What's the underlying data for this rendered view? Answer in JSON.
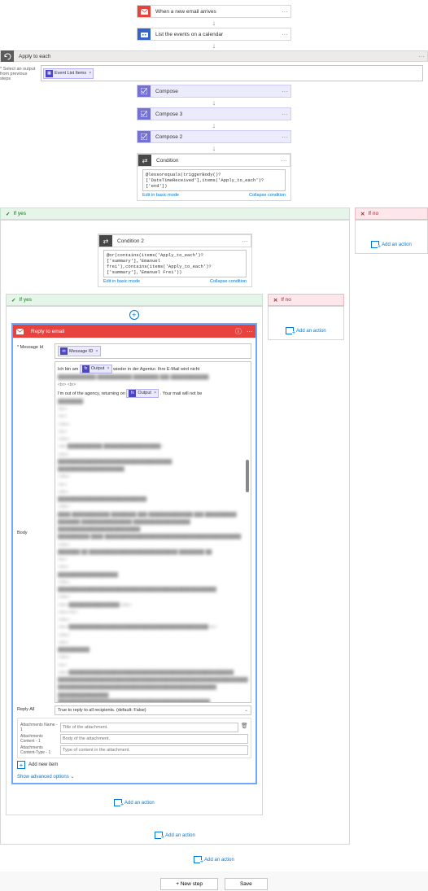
{
  "trigger": {
    "title": "When a new email arrives"
  },
  "list_events": {
    "title": "List the events on a calendar"
  },
  "foreach": {
    "title": "Apply to each",
    "select_label": "* Select an output from previous steps",
    "token": "Event List Items"
  },
  "compose": [
    {
      "title": "Compose"
    },
    {
      "title": "Compose 3"
    },
    {
      "title": "Compose 2"
    }
  ],
  "condition": {
    "title": "Condition",
    "expr": "@lessorequals(triggerBody()?['DateTimeReceived'],items('Apply_to_each')?['end'])",
    "edit": "Edit in basic mode",
    "collapse": "Collapse condition"
  },
  "branches": {
    "yes": "If yes",
    "no": "If no"
  },
  "condition2": {
    "title": "Condition 2",
    "expr": "@or(contains(items('Apply_to_each')?['summary'],'Emanuel frei'),contains(items('Apply_to_each')?['summary'],'Emanuel Frei'))",
    "edit": "Edit in basic mode",
    "collapse": "Collapse condition"
  },
  "reply": {
    "title": "Reply to email",
    "fields": {
      "message_id": {
        "label": "* Message Id",
        "token": "Message ID"
      },
      "body": {
        "label": "Body",
        "line1_pre": "Ich bin am ",
        "line1_tok": "Output",
        "line1_post": " wieder in der Agentur. Ihre E-Mail wird nicht",
        "line2_pre": "I'm out of the agency, returning on ",
        "line2_tok": "Output",
        "line2_post": ". Your mail will not be"
      },
      "reply_all": {
        "label": "Reply All",
        "value": "True to reply to all recipients. (default: False)"
      },
      "att_name": {
        "label": "Attachments Name - 1",
        "placeholder": "Title of the attachment."
      },
      "att_content": {
        "label": "Attachments Content - 1",
        "placeholder": "Body of the attachment."
      },
      "att_type": {
        "label": "Attachments Content-Type - 1",
        "placeholder": "Type of content in the attachment."
      }
    },
    "add_item": "Add new item",
    "advanced": "Show advanced options"
  },
  "actions": {
    "add": "Add an action",
    "new_step": "+ New step",
    "save": "Save"
  }
}
